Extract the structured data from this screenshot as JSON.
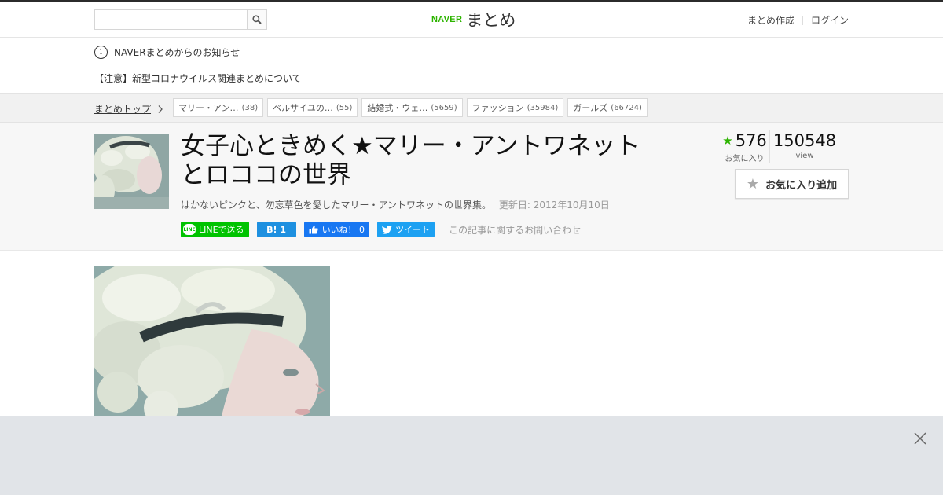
{
  "header": {
    "search": {
      "placeholder": "",
      "value": ""
    },
    "logo": {
      "brand": "NAVER",
      "name": "まとめ"
    },
    "links": {
      "create": "まとめ作成",
      "login": "ログイン"
    }
  },
  "notice": {
    "info_glyph": "i",
    "title": "NAVERまとめからのお知らせ",
    "caution": "【注意】新型コロナウイルス関連まとめについて"
  },
  "breadcrumb": {
    "top": "まとめトップ",
    "tags": [
      {
        "label": "マリー・アン…",
        "count": "(38)"
      },
      {
        "label": "ベルサイユの…",
        "count": "(55)"
      },
      {
        "label": "結婚式・ウェ…",
        "count": "(5659)"
      },
      {
        "label": "ファッション",
        "count": "(35984)"
      },
      {
        "label": "ガールズ",
        "count": "(66724)"
      }
    ]
  },
  "article": {
    "title": "女子心ときめく★マリー・アントワネットとロココの世界",
    "description": "はかないピンクと、勿忘草色を愛したマリー・アントワネットの世界集。",
    "updated": "更新日: 2012年10月10日",
    "share": {
      "line": "LINEで送る",
      "line_icon": "LINE",
      "hatena": "B! 1",
      "facebook": "いいね！ 0",
      "twitter": "ツイート",
      "inquiry": "この記事に関するお問い合わせ"
    },
    "stats": {
      "favorites": "576",
      "favorites_label": "お気に入り",
      "views": "150548",
      "views_label": "view"
    },
    "fav_button": "お気に入り追加"
  },
  "colors": {
    "brand_green": "#2db400",
    "line_green": "#00c300",
    "hatena_blue": "#1e90e0",
    "facebook_blue": "#1877f2",
    "twitter_blue": "#1da1f2",
    "ad_bg": "#e1e4e8"
  },
  "icons": [
    "search-icon",
    "info-icon",
    "chevron-right-icon",
    "star-icon",
    "line-icon",
    "facebook-like-icon",
    "twitter-bird-icon",
    "close-icon"
  ]
}
